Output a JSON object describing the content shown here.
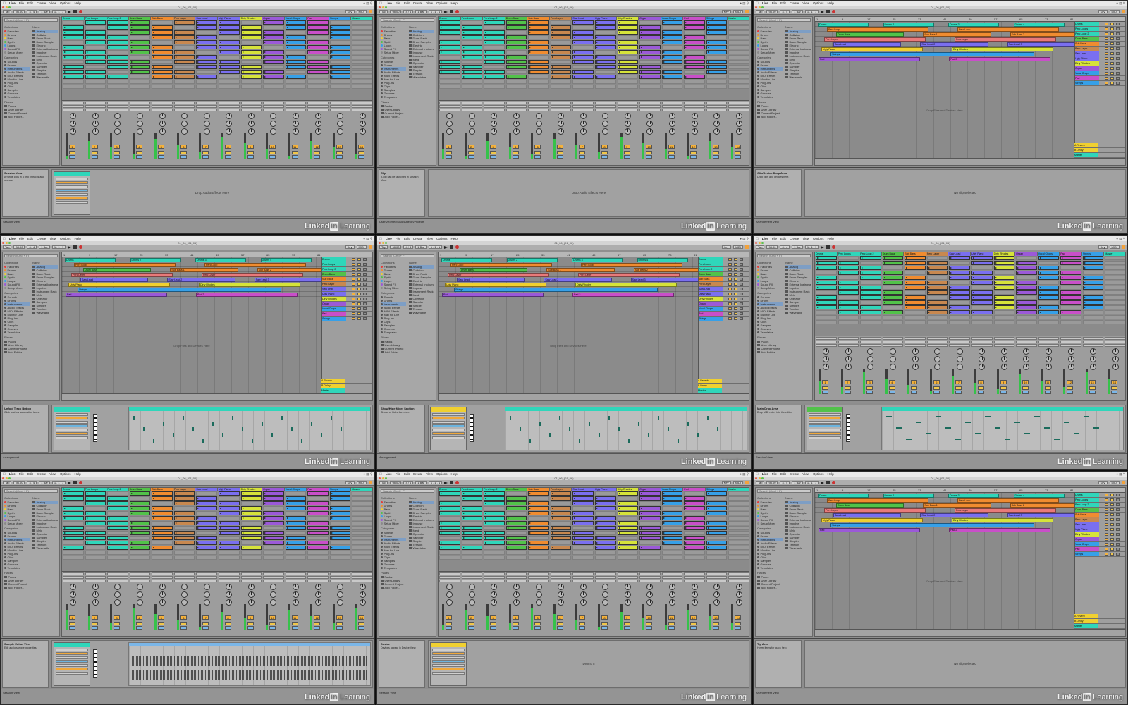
{
  "menu": {
    "items": [
      "Live",
      "File",
      "Edit",
      "Create",
      "View",
      "Options",
      "Help"
    ]
  },
  "window_title": "01_06_(01_06)",
  "transport": {
    "tap": "Tap",
    "tempo": "98.00",
    "meter": "4 / 4",
    "quantize": "1 Bar",
    "position": "1 . 1 . 1",
    "key_label": "Key",
    "midi_label": "MIDI"
  },
  "watermark": {
    "brand_a": "Linked",
    "brand_b": "in",
    "brand_c": "Learning"
  },
  "search_placeholder": "Search (Cmd + F)",
  "colors": {
    "accent": "#f5b23c",
    "selection": "#7d9ec5",
    "bg": "#8f8f8f"
  },
  "browser": {
    "collections_title": "Collections",
    "collections": [
      {
        "label": "Favorites",
        "color": "#e33b3b"
      },
      {
        "label": "Drums",
        "color": "#f08c30"
      },
      {
        "label": "Bass",
        "color": "#f0d030"
      },
      {
        "label": "Synth",
        "color": "#52c24a"
      },
      {
        "label": "Loops",
        "color": "#36a0e8"
      },
      {
        "label": "Sound FX",
        "color": "#9b59d8"
      },
      {
        "label": "Setup Mixer",
        "color": "#8a8a8a"
      }
    ],
    "categories_title": "Categories",
    "categories": [
      "Sounds",
      "Drums",
      "Instruments",
      "Audio Effects",
      "MIDI Effects",
      "Max for Live",
      "Plug-Ins",
      "Clips",
      "Samples",
      "Grooves",
      "Templates"
    ],
    "places_title": "Places",
    "places": [
      "Packs",
      "User Library",
      "Current Project",
      "Add Folder..."
    ],
    "list_title": "Name",
    "list": [
      "Analog",
      "Collision",
      "Drum Rack",
      "Drum Sampler",
      "Electric",
      "External Instrument",
      "Impulse",
      "Instrument Rack",
      "Meld",
      "Operator",
      "Sampler",
      "Simpler",
      "Tension",
      "Wavetable"
    ]
  },
  "tracks": [
    {
      "name": "Drums",
      "color": "#2fd6ba"
    },
    {
      "name": "Perc Loops",
      "color": "#2fd6ba"
    },
    {
      "name": "Perc Loop 2",
      "color": "#2fd6ba"
    },
    {
      "name": "Drum Bass",
      "color": "#52c24a"
    },
    {
      "name": "Sub Bass",
      "color": "#f08c30"
    },
    {
      "name": "Perc Layer",
      "color": "#c8884f"
    },
    {
      "name": "Saw Lead",
      "color": "#7a6ff0"
    },
    {
      "name": "Ugly Piano",
      "color": "#7a6ff0"
    },
    {
      "name": "Dirty Rhodes",
      "color": "#d6e33a"
    },
    {
      "name": "Organ",
      "color": "#9b59d8"
    },
    {
      "name": "Vocal Chops",
      "color": "#36a0e8"
    },
    {
      "name": "Pad",
      "color": "#c94fc9"
    },
    {
      "name": "Strings",
      "color": "#36a0e8"
    },
    {
      "name": "Master",
      "color": "#2fd6ba"
    }
  ],
  "arrangement": {
    "ruler": [
      "1",
      "9",
      "17",
      "25",
      "33",
      "41",
      "49",
      "57",
      "65",
      "73",
      "81"
    ],
    "clips": [
      [
        {
          "label": "Drums",
          "color": "#2fd6ba"
        },
        {
          "label": "Drums 2",
          "color": "#2fd6ba"
        },
        {
          "label": "Drums 3",
          "color": "#2fd6ba"
        },
        {
          "label": "Drums 4",
          "color": "#2fd6ba"
        }
      ],
      [
        {
          "label": "Perc Loop",
          "color": "#f08c30"
        },
        {
          "label": "Perc Loop",
          "color": "#f08c30"
        }
      ],
      [
        {
          "label": "Drum Bass",
          "color": "#52c24a"
        },
        {
          "label": "Sub Bass 1",
          "color": "#f08c30"
        },
        {
          "label": "Sub Bass 2",
          "color": "#f08c30"
        }
      ],
      [
        {
          "label": "Perc Layer",
          "color": "#e87a7a"
        },
        {
          "label": "Perc Layer",
          "color": "#e87a7a"
        }
      ],
      [
        {
          "label": "Saw Lead",
          "color": "#7a6ff0"
        },
        {
          "label": "Saw Lead 2",
          "color": "#7a6ff0"
        },
        {
          "label": "Saw Lead 3",
          "color": "#7a6ff0"
        }
      ],
      [
        {
          "label": "Ugly Piano",
          "color": "#f0d030"
        },
        {
          "label": "Dirty Rhodes",
          "color": "#d6e33a"
        }
      ],
      [
        {
          "label": "Strings",
          "color": "#36a0e8"
        }
      ],
      [
        {
          "label": "Pad",
          "color": "#9b59d8"
        },
        {
          "label": "Pad 2",
          "color": "#c94fc9"
        }
      ]
    ],
    "hint": "Drop Files and Devices Here",
    "return_tracks": [
      "A Reverb",
      "B Delay",
      "Master"
    ]
  },
  "panels": [
    {
      "view": "session",
      "info_title": "Session View",
      "info_text": "Arrange clips in a grid of tracks and scenes.",
      "detail_type": "clip",
      "detail_msg": "Drop Audio Effects Here",
      "path": "Session View"
    },
    {
      "view": "session",
      "info_title": "Clip",
      "info_text": "A clip can be launched in Session View.",
      "detail_type": "msg",
      "detail_msg": "Drop Audio Effects Here",
      "path": "Users/Home/Music/Ableton/Projects"
    },
    {
      "view": "arrangement",
      "info_title": "Clip/Device Drop Area",
      "info_text": "Drag clips and devices here.",
      "detail_type": "msg",
      "detail_msg": "No clip selected",
      "path": "Arrangement View"
    },
    {
      "view": "arrangement",
      "info_title": "Unfold Track Button",
      "info_text": "Click to show automation lanes.",
      "detail_type": "midi",
      "detail_msg": "",
      "path": "Arrangement"
    },
    {
      "view": "arrangement",
      "info_title": "Show/Hide Mixer Section",
      "info_text": "Shows or hides the mixer.",
      "detail_type": "midi",
      "detail_msg": "",
      "path": "Arrangement"
    },
    {
      "view": "session",
      "info_title": "Main Drop Area",
      "info_text": "Drop MIDI notes into the editor.",
      "detail_type": "notes",
      "detail_msg": "",
      "path": "Session View"
    },
    {
      "view": "session",
      "info_title": "Sample Editor View",
      "info_text": "Edit audio sample properties.",
      "detail_type": "audio",
      "detail_msg": "",
      "path": "Session View"
    },
    {
      "view": "session",
      "info_title": "Device",
      "info_text": "Devices appear in Device View.",
      "detail_type": "device",
      "detail_msg": "Drums 5",
      "path": "Session View"
    },
    {
      "view": "arrangement",
      "info_title": "Tip Area",
      "info_text": "Hover items for quick help.",
      "detail_type": "msg",
      "detail_msg": "No clip selected",
      "path": "Arrangement View"
    }
  ]
}
